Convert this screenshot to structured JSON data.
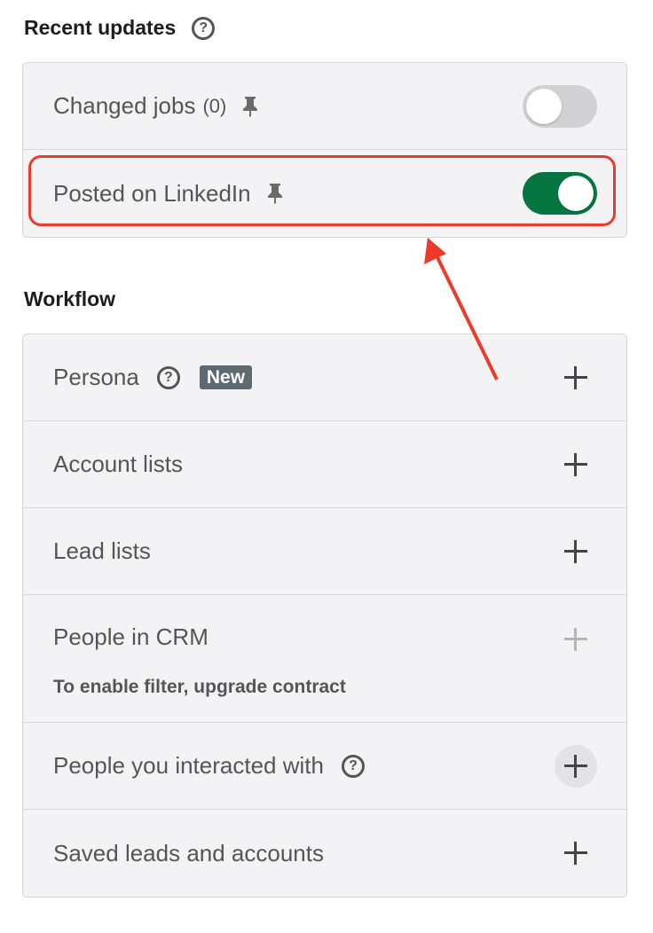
{
  "recent_updates": {
    "title": "Recent updates",
    "help_icon": "question-circle-icon",
    "items": [
      {
        "label": "Changed jobs",
        "count": "(0)",
        "pin_icon": "pin-icon",
        "toggle": "off"
      },
      {
        "label": "Posted on LinkedIn",
        "pin_icon": "pin-icon",
        "toggle": "on"
      }
    ]
  },
  "workflow": {
    "title": "Workflow",
    "items": [
      {
        "label": "Persona",
        "help_icon": "question-circle-icon",
        "badge": "New",
        "action_icon": "plus-icon"
      },
      {
        "label": "Account lists",
        "action_icon": "plus-icon"
      },
      {
        "label": "Lead lists",
        "action_icon": "plus-icon"
      },
      {
        "label": "People in CRM",
        "note": "To enable filter, upgrade contract",
        "action_icon": "plus-icon",
        "disabled": true
      },
      {
        "label": "People you interacted with",
        "help_icon": "question-circle-icon",
        "action_icon": "plus-icon"
      },
      {
        "label": "Saved leads and accounts",
        "action_icon": "plus-icon"
      }
    ]
  },
  "colors": {
    "toggle_on": "#057642",
    "toggle_off": "#d1d1d3",
    "annotation_red": "#ee3a2a",
    "card_bg": "#f3f3f5",
    "badge_bg": "#5e6a72"
  }
}
